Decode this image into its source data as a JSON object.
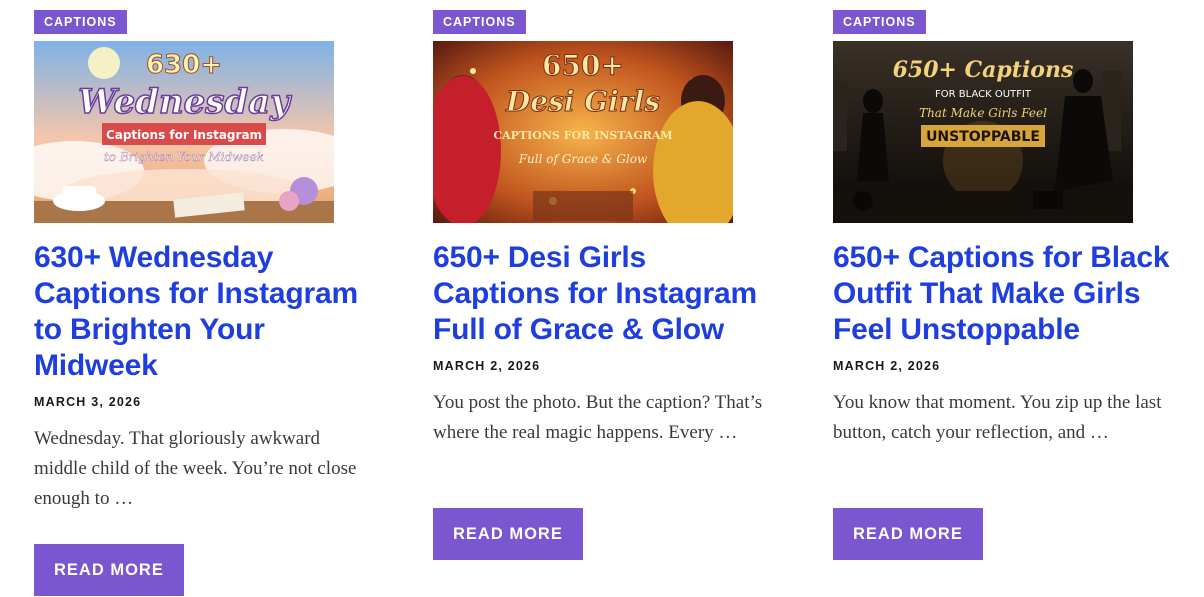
{
  "cards": [
    {
      "category": "CAPTIONS",
      "thumbnail": {
        "line1": "630+",
        "line2": "Wednesday",
        "banner": "Captions for Instagram",
        "tagline": "to Brighten Your Midweek"
      },
      "title": "630+ Wednesday Captions for Instagram to Brighten Your Midweek",
      "date": "MARCH 3, 2026",
      "excerpt": "Wednesday. That gloriously awkward middle child of the week. You’re not close enough to …",
      "button": "READ MORE"
    },
    {
      "category": "CAPTIONS",
      "thumbnail": {
        "line1": "650+",
        "line2": "Desi Girls",
        "banner": "CAPTIONS FOR INSTAGRAM",
        "tagline": "Full of Grace & Glow"
      },
      "title": "650+ Desi Girls Captions for Instagram Full of Grace & Glow",
      "date": "MARCH 2, 2026",
      "excerpt": "You post the photo. But the caption? That’s where the real magic happens. Every …",
      "button": "READ MORE"
    },
    {
      "category": "CAPTIONS",
      "thumbnail": {
        "line1": "650+ Captions",
        "line2": "FOR BLACK OUTFIT",
        "banner": "That Make Girls Feel",
        "tagline": "UNSTOPPABLE"
      },
      "title": "650+ Captions for Black Outfit That Make Girls Feel Unstoppable",
      "date": "MARCH 2, 2026",
      "excerpt": "You know that moment. You zip up the last button, catch your reflection, and …",
      "button": "READ MORE"
    }
  ],
  "colors": {
    "accent": "#7a57d1",
    "title_link": "#1f3ee0"
  }
}
